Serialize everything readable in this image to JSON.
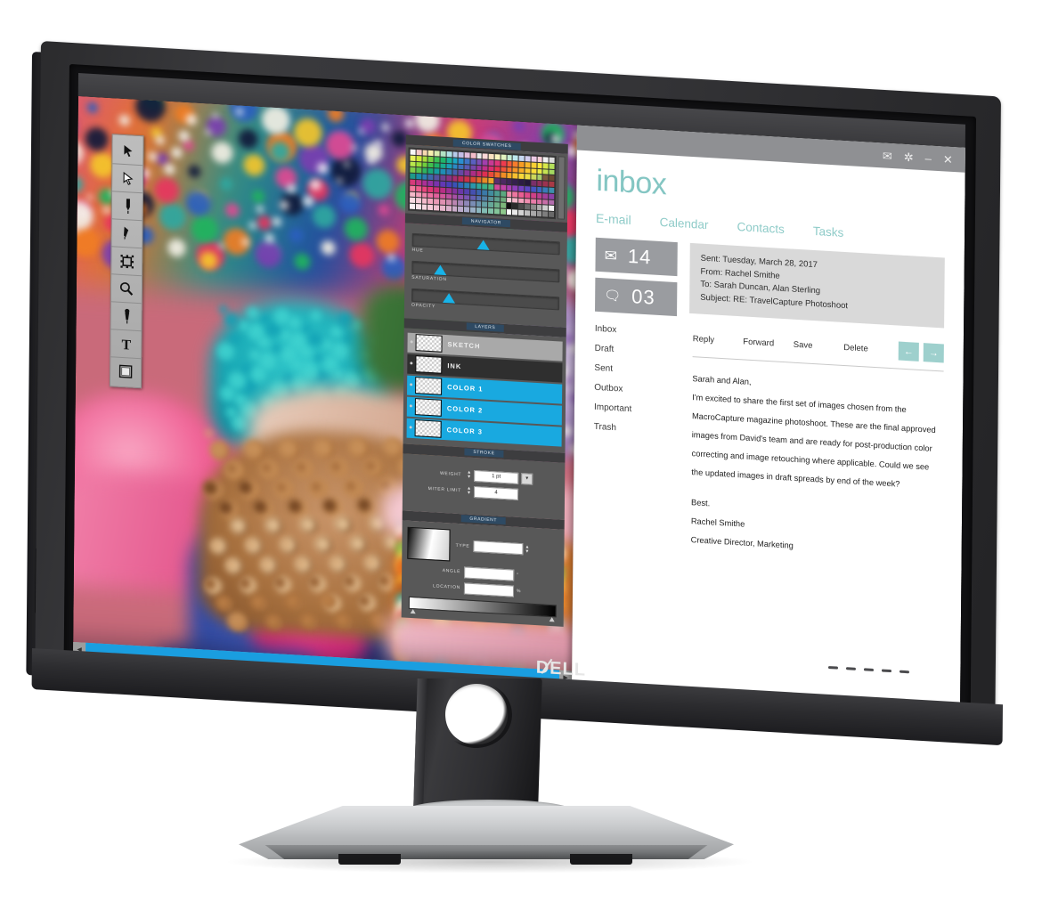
{
  "product": {
    "brand": "DELL",
    "type": "monitor-product-photo"
  },
  "graphics_app": {
    "window_controls": [
      {
        "name": "maximize",
        "glyph": "❐"
      },
      {
        "name": "minimize",
        "glyph": "–"
      },
      {
        "name": "close",
        "glyph": "✕"
      }
    ],
    "toolbar": {
      "tools": [
        {
          "name": "selection-arrow-tool",
          "label": "Selection"
        },
        {
          "name": "direct-selection-tool",
          "label": "Direct Selection"
        },
        {
          "name": "pencil-tool",
          "label": "Pencil"
        },
        {
          "name": "pen-tool",
          "label": "Pen"
        },
        {
          "name": "free-transform-tool",
          "label": "Free Transform"
        },
        {
          "name": "zoom-tool",
          "label": "Zoom"
        },
        {
          "name": "brush-tool",
          "label": "Brush"
        },
        {
          "name": "type-tool",
          "label": "Type"
        },
        {
          "name": "fill-stroke-swatch",
          "label": "Fill / Stroke"
        }
      ]
    },
    "panels": {
      "swatches": {
        "title": "COLOR SWATCHES",
        "columns": 24,
        "rows": 10,
        "colors": [
          "#f7f7f7",
          "#f7c9c9",
          "#f7d9b0",
          "#f6efae",
          "#d9edb0",
          "#b2e2c4",
          "#aee0e6",
          "#b6cbea",
          "#c3bde6",
          "#e2bcdc",
          "#f3bcc8",
          "#e8e8e8",
          "#fbd7d7",
          "#fae2c1",
          "#faf5bf",
          "#e3f2bf",
          "#c3ead2",
          "#bfe8ee",
          "#c6d7f0",
          "#d2cdee",
          "#ecc9e4",
          "#f9cdd7",
          "#f2f2f2",
          "#dcdcdc",
          "#e8f25c",
          "#cfe83c",
          "#a8dd3c",
          "#74cf45",
          "#3cbf56",
          "#21b46a",
          "#18b09b",
          "#1aa7c4",
          "#2a8fd0",
          "#3f74c6",
          "#5a5fc0",
          "#7a4fb8",
          "#a33fae",
          "#c93a94",
          "#e0347a",
          "#ef3b4f",
          "#f45a3a",
          "#f67c2c",
          "#f89c24",
          "#fab62a",
          "#fbd033",
          "#fbe63c",
          "#d8e84a",
          "#b4e05a",
          "#b9e84c",
          "#9adf3a",
          "#6fd03c",
          "#3fc04e",
          "#1fb364",
          "#17ad8e",
          "#1aa0b8",
          "#2b8ac6",
          "#3f70bc",
          "#5a5bb4",
          "#7648ab",
          "#9a37a0",
          "#bf2f8c",
          "#d92d72",
          "#ec3150",
          "#f2553a",
          "#f4742c",
          "#f69526",
          "#f8ae27",
          "#fac830",
          "#fbdd39",
          "#e9ea45",
          "#c6e352",
          "#a5da60",
          "#7fce4a",
          "#59c14d",
          "#2fb35f",
          "#1aa878",
          "#169ea0",
          "#1f8eb6",
          "#3176b6",
          "#4a5faf",
          "#6648a4",
          "#8a3797",
          "#ad2d86",
          "#c92b6e",
          "#de2f52",
          "#ea4c3a",
          "#ee6b2c",
          "#f18d25",
          "#f4a726",
          "#f7c02f",
          "#f9d839",
          "#ecde45",
          "#ccd85b",
          "#a8cd6c",
          "#7c5a3e",
          "#6b4a32",
          "#1e9a8a",
          "#1a8ea8",
          "#2a7fb2",
          "#3e68aa",
          "#56539f",
          "#6f4192",
          "#8c3284",
          "#a62c72",
          "#bc2b5c",
          "#cc3247",
          "#d84a36",
          "#e06a2a",
          "#e68c26",
          "#ec a82c",
          "#5a2f6e",
          "#4d2a63",
          "#3f2558",
          "#35204e",
          "#2c1c44",
          "#24183a",
          "#7a2f6a",
          "#8e2f5c",
          "#9c3250",
          "#a83a46",
          "#d63a7a",
          "#c4338a",
          "#ad2f98",
          "#9430a4",
          "#7a33ae",
          "#6238b4",
          "#4a3fb8",
          "#3a52b8",
          "#2f69b6",
          "#2a80b2",
          "#2a96ab",
          "#2ea69c",
          "#3bb08a",
          "#4fb777",
          "#d14a9a",
          "#c244a6",
          "#aa40b2",
          "#8f3fba",
          "#7441bf",
          "#5c47c2",
          "#4854c2",
          "#3c66bf",
          "#3a7bb8",
          "#3d90ae",
          "#f27a9e",
          "#ef5f8e",
          "#e9457f",
          "#de3575",
          "#cd2f78",
          "#b72f85",
          "#9e3093",
          "#84339f",
          "#6b38a8",
          "#5640ae",
          "#4550b0",
          "#3b64ae",
          "#3b79a8",
          "#428c9e",
          "#4d9c90",
          "#5ba87f",
          "#f08fae",
          "#ee76a0",
          "#ea5e93",
          "#e04c8b",
          "#cf4188",
          "#bb3f90",
          "#a23f9c",
          "#8a41a6",
          "#f5b9c9",
          "#f3a0bb",
          "#f187ad",
          "#ec6fa2",
          "#e25f9c",
          "#d2579b",
          "#be529f",
          "#a850a6",
          "#9151ad",
          "#7a55b2",
          "#6560b3",
          "#5670ae",
          "#5380a6",
          "#57909a",
          "#60a08c",
          "#6dab7c",
          "#f7cdd8",
          "#f5b8ca",
          "#f3a3bd",
          "#ef8eb0",
          "#e87ca8",
          "#da72a6",
          "#c86ea8",
          "#b26dad",
          "#f9dde4",
          "#f7ccd8",
          "#f5bbcc",
          "#f2a9c0",
          "#eb9ab6",
          "#df90b1",
          "#cf8ab0",
          "#bb86b2",
          "#a585b6",
          "#8e87b8",
          "#7a8db5",
          "#6b95ae",
          "#649ea4",
          "#66a898",
          "#6fb089",
          "#7cb67a",
          "#111111",
          "#2b2b2b",
          "#4a4a4a",
          "#6b6b6b",
          "#8c8c8c",
          "#adadad",
          "#cfcfcf",
          "#f0f0f0",
          "#fbeff2",
          "#f9e3ea",
          "#f7d7e1",
          "#f5cbd8",
          "#f0bfd0",
          "#e7b6cc",
          "#dab0cb",
          "#cbacca",
          "#bbabcb",
          "#aaabca",
          "#9ab0c6",
          "#8cb6bf",
          "#82bcb4",
          "#80c1a8",
          "#84c59a",
          "#8ec98c",
          "#ffffff",
          "#eaeaea",
          "#d4d4d4",
          "#bfbfbf",
          "#a9a9a9",
          "#949494",
          "#7e7e7e",
          "#696969"
        ]
      },
      "navigator": {
        "title": "NAVIGATOR",
        "sliders": [
          {
            "label": "HUE",
            "value": 46
          },
          {
            "label": "SATURATION",
            "value": 17
          },
          {
            "label": "OPACITY",
            "value": 23
          }
        ]
      },
      "layers": {
        "title": "LAYERS",
        "items": [
          {
            "name": "SKETCH",
            "color": "#a9a9a9",
            "text": "#efefef",
            "selected": true
          },
          {
            "name": "INK",
            "color": "#2f2f2f",
            "text": "#f0f0f0",
            "selected": false
          },
          {
            "name": "COLOR 1",
            "color": "#19a9e0",
            "text": "#ffffff",
            "selected": false
          },
          {
            "name": "COLOR 2",
            "color": "#19a9e0",
            "text": "#ffffff",
            "selected": false
          },
          {
            "name": "COLOR 3",
            "color": "#19a9e0",
            "text": "#ffffff",
            "selected": false
          }
        ]
      },
      "stroke": {
        "title": "STROKE",
        "weight_label": "WEIGHT",
        "weight_value": "1  pt",
        "miter_label": "MITER LIMIT",
        "miter_value": "4"
      },
      "gradient": {
        "title": "GRADIENT",
        "type_label": "TYPE",
        "type_value": "",
        "angle_label": "ANGLE",
        "angle_value": "",
        "angle_unit": "°",
        "location_label": "LOCATION",
        "location_value": "",
        "location_unit": "%"
      }
    },
    "scrollbar": {
      "left_arrow": "◀",
      "right_arrow": "▶"
    }
  },
  "mail_app": {
    "window_controls": [
      {
        "name": "new-mail",
        "glyph": "✉"
      },
      {
        "name": "settings",
        "glyph": "✲"
      },
      {
        "name": "minimize",
        "glyph": "–"
      },
      {
        "name": "close",
        "glyph": "✕"
      }
    ],
    "title": "inbox",
    "accent_color": "#8ecbc8",
    "tabs": [
      {
        "label": "E-mail",
        "active": true
      },
      {
        "label": "Calendar",
        "active": false
      },
      {
        "label": "Contacts",
        "active": false
      },
      {
        "label": "Tasks",
        "active": false
      }
    ],
    "counters": [
      {
        "icon": "envelope-icon",
        "glyph": "✉",
        "value": "14"
      },
      {
        "icon": "chat-bubble-icon",
        "glyph": "🗨",
        "value": "03"
      }
    ],
    "summary": {
      "sent": "Sent: Tuesday, March 28, 2017",
      "from": "From: Rachel Smithe",
      "to": "To: Sarah Duncan, Alan Sterling",
      "subject": "Subject: RE: TravelCapture Photoshoot"
    },
    "folders": [
      "Inbox",
      "Draft",
      "Sent",
      "Outbox",
      "Important",
      "Trash"
    ],
    "actions": [
      "Reply",
      "Forward",
      "Save",
      "Delete"
    ],
    "nav_buttons": [
      {
        "name": "previous-message",
        "glyph": "←"
      },
      {
        "name": "next-message",
        "glyph": "→"
      }
    ],
    "message": {
      "greeting": "Sarah and Alan,",
      "paragraph": "I'm excited to share the first set of images chosen from the MacroCapture magazine photoshoot. These are the final approved images from David's team and are ready for post-production color correcting and image retouching where applicable.  Could we see the updated images in draft spreads by end of the week?",
      "closing": "Best.",
      "signature_name": "Rachel Smithe",
      "signature_title": "Creative Director, Marketing"
    }
  }
}
